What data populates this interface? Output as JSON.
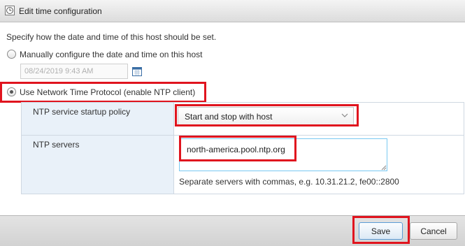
{
  "dialog": {
    "title": "Edit time configuration",
    "description": "Specify how the date and time of this host should be set."
  },
  "manual": {
    "label": "Manually configure the date and time on this host",
    "selected": false,
    "date_value": "08/24/2019 9:43 AM"
  },
  "ntp": {
    "label": "Use Network Time Protocol (enable NTP client)",
    "selected": true,
    "startup_policy_label": "NTP service startup policy",
    "startup_policy_value": "Start and stop with host",
    "servers_label": "NTP servers",
    "servers_value": "north-america.pool.ntp.org",
    "servers_hint": "Separate servers with commas, e.g. 10.31.21.2, fe00::2800"
  },
  "buttons": {
    "save": "Save",
    "cancel": "Cancel"
  },
  "colors": {
    "highlight": "#e0141e",
    "accent": "#5b9cd6"
  },
  "icons": {
    "title": "clock-icon",
    "date_picker": "calendar-icon",
    "select": "chevron-down-icon"
  }
}
